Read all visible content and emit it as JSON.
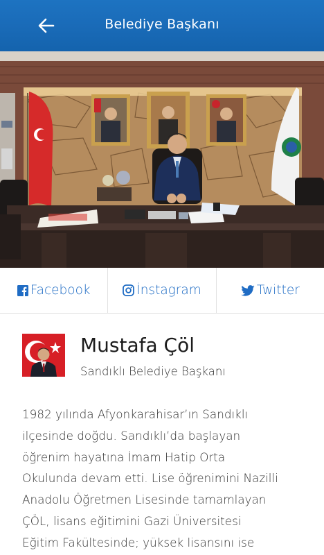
{
  "header": {
    "title": "Belediye Başkanı",
    "back_icon": "arrow-left-icon",
    "background": "#1a6bb8"
  },
  "social": {
    "items": [
      {
        "label": "Facebook",
        "icon": "facebook-icon"
      },
      {
        "label": "İnstagram",
        "icon": "instagram-icon"
      },
      {
        "label": "Twitter",
        "icon": "twitter-icon"
      }
    ],
    "color": "#1f6cc4"
  },
  "profile": {
    "name": "Mustafa Çöl",
    "role": "Sandıklı Belediye Başkanı"
  },
  "bio": {
    "lines": [
      "1982 yılında Afyonkarahisar’ın Sandıklı",
      "ilçesinde doğdu. Sandıklı’da başlayan",
      "öğrenim hayatına İmam Hatip Orta",
      "Okulunda devam etti. Lise öğrenimini Nazilli",
      "Anadolu Öğretmen Lisesinde tamamlayan",
      "ÇÖL, lisans eğitimini Gazi Üniversitesi",
      "Eğitim Fakültesinde; yüksek lisansını ise"
    ]
  }
}
